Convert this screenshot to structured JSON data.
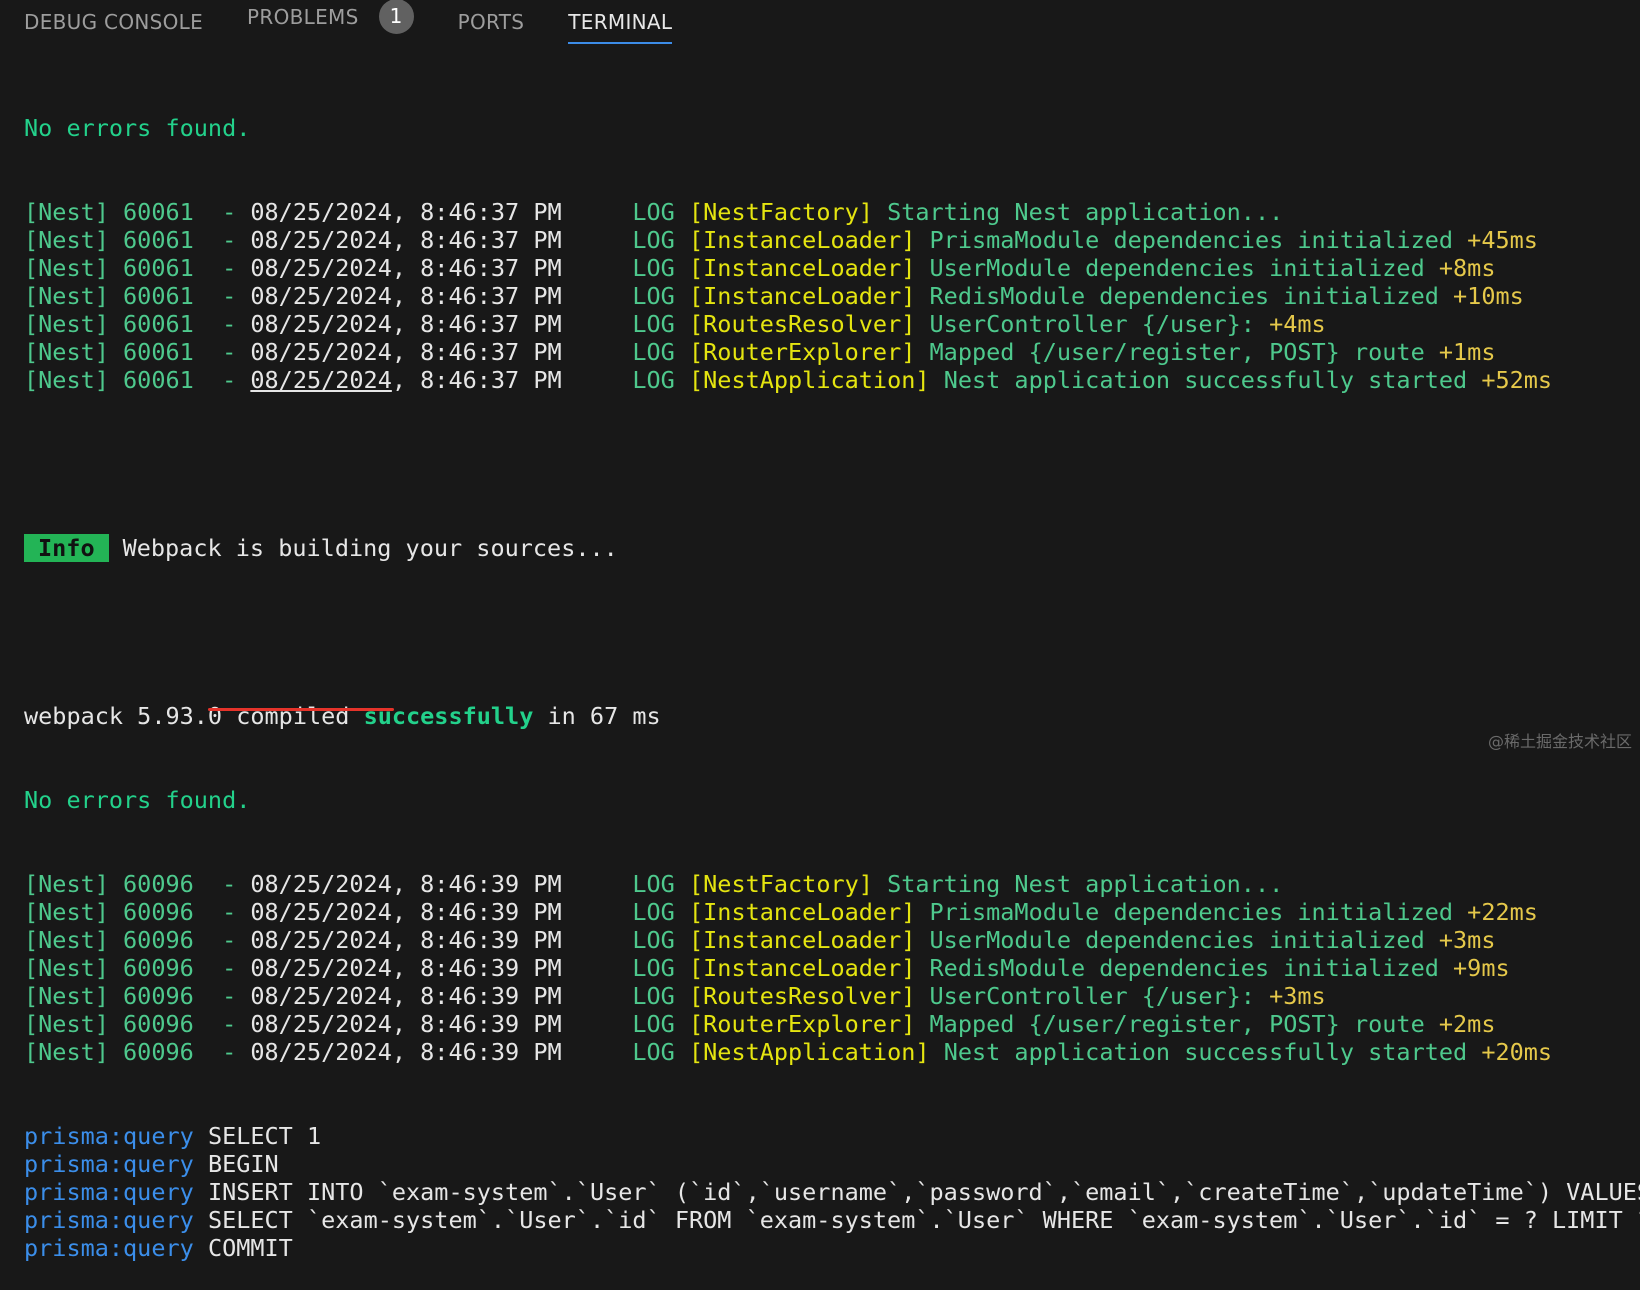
{
  "tabs": [
    {
      "label": "DEBUG CONSOLE"
    },
    {
      "label": "PROBLEMS",
      "badge": "1"
    },
    {
      "label": "PORTS"
    },
    {
      "label": "TERMINAL",
      "active": true
    }
  ],
  "terminal": {
    "no_errors_1": "No errors found.",
    "run1": {
      "prefix": "[Nest] 60061  - ",
      "timestamp": "08/25/2024, 8:46:37 PM",
      "lines": [
        {
          "level": "LOG",
          "context": "[NestFactory]",
          "message": "Starting Nest application...",
          "time": ""
        },
        {
          "level": "LOG",
          "context": "[InstanceLoader]",
          "message": "PrismaModule dependencies initialized",
          "time": "+45ms"
        },
        {
          "level": "LOG",
          "context": "[InstanceLoader]",
          "message": "UserModule dependencies initialized",
          "time": "+8ms"
        },
        {
          "level": "LOG",
          "context": "[InstanceLoader]",
          "message": "RedisModule dependencies initialized",
          "time": "+10ms"
        },
        {
          "level": "LOG",
          "context": "[RoutesResolver]",
          "message": "UserController {/user}:",
          "time": "+4ms"
        },
        {
          "level": "LOG",
          "context": "[RouterExplorer]",
          "message": "Mapped {/user/register, POST} route",
          "time": "+1ms"
        },
        {
          "level": "LOG",
          "context": "[NestApplication]",
          "message": "Nest application successfully started",
          "time": "+52ms"
        }
      ]
    },
    "info_badge": "Info",
    "info_text": "Webpack is building your sources...",
    "compile_prefix": "webpack 5.93.0 compiled ",
    "compile_status": "successfully",
    "compile_suffix": " in 67 ms",
    "no_errors_2": "No errors found.",
    "run2": {
      "prefix": "[Nest] 60096  - ",
      "timestamp": "08/25/2024, 8:46:39 PM",
      "lines": [
        {
          "level": "LOG",
          "context": "[NestFactory]",
          "message": "Starting Nest application...",
          "time": ""
        },
        {
          "level": "LOG",
          "context": "[InstanceLoader]",
          "message": "PrismaModule dependencies initialized",
          "time": "+22ms"
        },
        {
          "level": "LOG",
          "context": "[InstanceLoader]",
          "message": "UserModule dependencies initialized",
          "time": "+3ms"
        },
        {
          "level": "LOG",
          "context": "[InstanceLoader]",
          "message": "RedisModule dependencies initialized",
          "time": "+9ms"
        },
        {
          "level": "LOG",
          "context": "[RoutesResolver]",
          "message": "UserController {/user}:",
          "time": "+3ms"
        },
        {
          "level": "LOG",
          "context": "[RouterExplorer]",
          "message": "Mapped {/user/register, POST} route",
          "time": "+2ms"
        },
        {
          "level": "LOG",
          "context": "[NestApplication]",
          "message": "Nest application successfully started",
          "time": "+20ms"
        }
      ]
    },
    "queries": [
      {
        "tag": "prisma:query",
        "sql": "SELECT 1"
      },
      {
        "tag": "prisma:query",
        "sql": "BEGIN"
      },
      {
        "tag": "prisma:query",
        "sql": "INSERT INTO `exam-system`.`User` (`id`,`username`,`password`,`email`,`createTime`,`updateTime`) VALUES"
      },
      {
        "tag": "prisma:query",
        "sql": "SELECT `exam-system`.`User`.`id` FROM `exam-system`.`User` WHERE `exam-system`.`User`.`id` = ? LIMIT ?"
      },
      {
        "tag": "prisma:query",
        "sql": "COMMIT"
      }
    ]
  },
  "watermark": "@稀土掘金技术社区",
  "colors": {
    "background": "#181818",
    "accent_tab_underline": "#3c8ce7",
    "annotation_red": "#e5332a"
  }
}
